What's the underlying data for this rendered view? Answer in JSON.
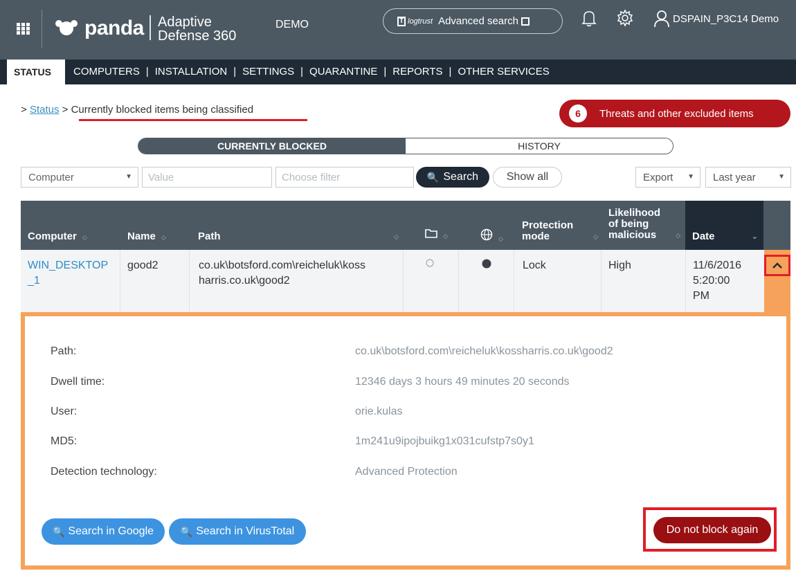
{
  "header": {
    "logo_text": "panda",
    "product_line1": "Adaptive",
    "product_line2": "Defense 360",
    "demo_label": "DEMO",
    "logtrust_label": "logtrust",
    "advanced_search_label": "Advanced search",
    "user_name": "DSPAIN_P3C14 Demo"
  },
  "nav": {
    "active": "STATUS",
    "items": [
      "COMPUTERS",
      "INSTALLATION",
      "SETTINGS",
      "QUARANTINE",
      "REPORTS",
      "OTHER SERVICES"
    ]
  },
  "breadcrumb": {
    "prefix": ">",
    "link": "Status",
    "separator": ">",
    "current": "Currently blocked items being classified"
  },
  "threats_badge": {
    "count": "6",
    "label": "Threats and other excluded items"
  },
  "view_toggle": {
    "active": "CURRENTLY BLOCKED",
    "inactive": "HISTORY"
  },
  "filters": {
    "field_select": "Computer",
    "value_placeholder": "Value",
    "filter_placeholder": "Choose filter",
    "search_label": "Search",
    "show_all_label": "Show all",
    "export_label": "Export",
    "period_select": "Last year"
  },
  "table": {
    "headers": {
      "computer": "Computer",
      "name": "Name",
      "path": "Path",
      "protection_mode": [
        "Protection",
        "mode"
      ],
      "likelihood": [
        "Likelihood",
        "of being",
        "malicious"
      ],
      "date": "Date"
    },
    "row": {
      "computer": [
        "WIN_DESKTOP",
        "_1"
      ],
      "name": "good2",
      "path": [
        "co.uk\\botsford.com\\reicheluk\\koss",
        "harris.co.uk\\good2"
      ],
      "protection_mode": "Lock",
      "likelihood": "High",
      "date": [
        "11/6/2016",
        "5:20:00",
        "PM"
      ]
    }
  },
  "detail": {
    "path_label": "Path:",
    "path_value": "co.uk\\botsford.com\\reicheluk\\kossharris.co.uk\\good2",
    "dwell_label": "Dwell time:",
    "dwell_value": "12346 days 3 hours 49 minutes 20 seconds",
    "user_label": "User:",
    "user_value": "orie.kulas",
    "md5_label": "MD5:",
    "md5_value": "1m241u9ipojbuikg1x031cufstp7s0y1",
    "tech_label": "Detection technology:",
    "tech_value": "Advanced Protection",
    "google_button": "Search in Google",
    "virustotal_button": "Search in VirusTotal",
    "no_block_button": "Do not block again"
  },
  "colors": {
    "header_bg": "#4c5963",
    "nav_bg": "#1f2a36",
    "accent_red": "#b3161c",
    "highlight_red": "#e01e26",
    "orange": "#f7a25a",
    "link_blue": "#2d8ccb",
    "button_blue": "#3d93e0"
  }
}
